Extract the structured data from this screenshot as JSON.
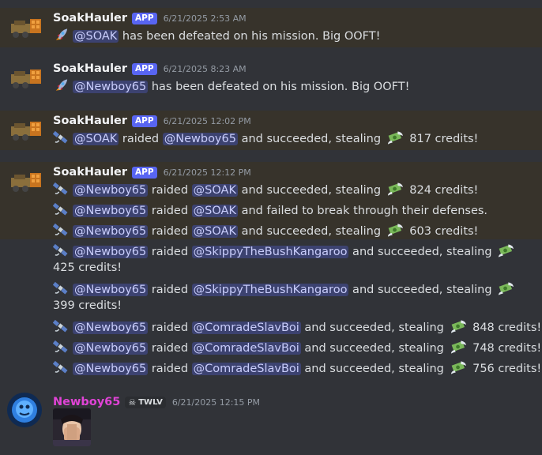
{
  "messages": [
    {
      "author": "SoakHauler",
      "badge": "APP",
      "timestamp": "6/21/2025 2:53 AM",
      "lines": [
        {
          "icon": "rocket-emoji",
          "parts": [
            {
              "m": "@SOAK"
            },
            {
              "t": " has been defeated on his mission. Big OOFT!"
            }
          ]
        }
      ]
    },
    {
      "author": "SoakHauler",
      "badge": "APP",
      "timestamp": "6/21/2025 8:23 AM",
      "lines": [
        {
          "icon": "rocket-emoji",
          "parts": [
            {
              "m": "@Newboy65"
            },
            {
              "t": " has been defeated on his mission. Big OOFT!"
            }
          ]
        }
      ]
    },
    {
      "author": "SoakHauler",
      "badge": "APP",
      "timestamp": "6/21/2025 12:02 PM",
      "lines": [
        {
          "icon": "satellite-emoji",
          "parts": [
            {
              "m": "@SOAK"
            },
            {
              "t": " raided "
            },
            {
              "m": "@Newboy65"
            },
            {
              "t": " and succeeded, stealing "
            },
            {
              "e": "money"
            },
            {
              "t": " 817 credits!"
            }
          ]
        }
      ]
    },
    {
      "author": "SoakHauler",
      "badge": "APP",
      "timestamp": "6/21/2025 12:12 PM",
      "lines": [
        {
          "icon": "satellite-emoji",
          "parts": [
            {
              "m": "@Newboy65"
            },
            {
              "t": " raided "
            },
            {
              "m": "@SOAK"
            },
            {
              "t": " and succeeded, stealing "
            },
            {
              "e": "money"
            },
            {
              "t": " 824 credits!"
            }
          ]
        },
        {
          "icon": "satellite-emoji",
          "parts": [
            {
              "m": "@Newboy65"
            },
            {
              "t": " raided "
            },
            {
              "m": "@SOAK"
            },
            {
              "t": " and failed to break through their defenses."
            }
          ]
        },
        {
          "icon": "satellite-emoji",
          "parts": [
            {
              "m": "@Newboy65"
            },
            {
              "t": " raided "
            },
            {
              "m": "@SOAK"
            },
            {
              "t": " and succeeded, stealing "
            },
            {
              "e": "money"
            },
            {
              "t": " 603 credits!"
            }
          ]
        },
        {
          "icon": "satellite-emoji",
          "parts": [
            {
              "m": "@Newboy65"
            },
            {
              "t": " raided "
            },
            {
              "m": "@SkippyTheBushKangaroo"
            },
            {
              "t": " and succeeded, stealing "
            },
            {
              "e": "money"
            },
            {
              "t": " 425 credits!"
            }
          ]
        },
        {
          "icon": "satellite-emoji",
          "parts": [
            {
              "m": "@Newboy65"
            },
            {
              "t": " raided "
            },
            {
              "m": "@SkippyTheBushKangaroo"
            },
            {
              "t": " and succeeded, stealing "
            },
            {
              "e": "money"
            },
            {
              "t": " 399 credits!"
            }
          ]
        },
        {
          "icon": "satellite-emoji",
          "parts": [
            {
              "m": "@Newboy65"
            },
            {
              "t": " raided "
            },
            {
              "m": "@ComradeSlavBoi"
            },
            {
              "t": " and succeeded, stealing "
            },
            {
              "e": "money"
            },
            {
              "t": " 848 credits!"
            }
          ]
        },
        {
          "icon": "satellite-emoji",
          "parts": [
            {
              "m": "@Newboy65"
            },
            {
              "t": " raided "
            },
            {
              "m": "@ComradeSlavBoi"
            },
            {
              "t": " and succeeded, stealing "
            },
            {
              "e": "money"
            },
            {
              "t": " 748 credits!"
            }
          ]
        },
        {
          "icon": "satellite-emoji",
          "parts": [
            {
              "m": "@Newboy65"
            },
            {
              "t": " raided "
            },
            {
              "m": "@ComradeSlavBoi"
            },
            {
              "t": " and succeeded, stealing "
            },
            {
              "e": "money"
            },
            {
              "t": " 756 credits!"
            }
          ]
        }
      ]
    },
    {
      "author": "Newboy65",
      "tag": "TWLV",
      "tag_icon": "skull-icon",
      "timestamp": "6/21/2025 12:15 PM",
      "attachment": "image-attachment",
      "lines": []
    }
  ],
  "colors": {
    "background": "#313338",
    "highlight": "#37332b",
    "mention_bg": "#3c4270",
    "mention_fg": "#c9cdfb",
    "app_badge": "#5865f2",
    "newboy_name": "#e043d6"
  }
}
